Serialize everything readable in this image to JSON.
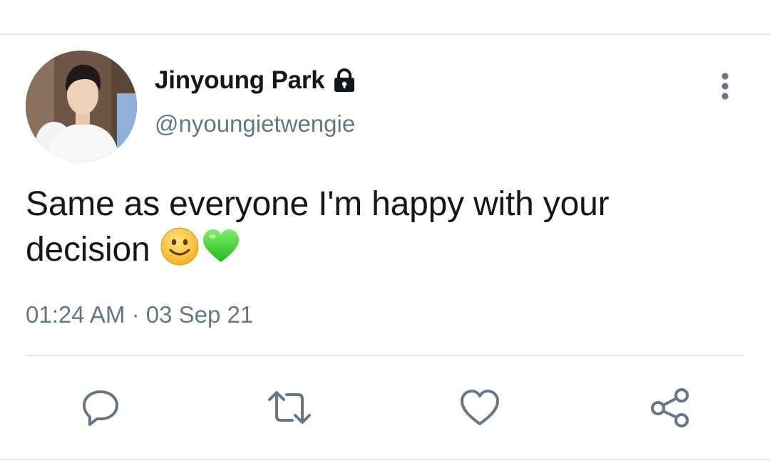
{
  "tweet": {
    "author": {
      "name": "Jinyoung Park",
      "handle": "@nyoungietwengie",
      "protected_icon": "lock-icon",
      "avatar_icon": "profile-photo"
    },
    "text": "Same as everyone I'm happy with your decision",
    "emojis": [
      "slightly-smiling-face-emoji",
      "green-heart-emoji"
    ],
    "timestamp": "01:24 AM · 03 Sep 21",
    "menu_icon": "more-vertical-icon",
    "actions": [
      {
        "name": "reply",
        "icon": "reply-icon"
      },
      {
        "name": "retweet",
        "icon": "retweet-icon"
      },
      {
        "name": "like",
        "icon": "heart-icon"
      },
      {
        "name": "share",
        "icon": "share-icon"
      }
    ]
  },
  "colors": {
    "text_primary": "#14171a",
    "text_secondary": "#657786",
    "divider": "#e6e8ea",
    "icon": "#657786",
    "green_heart": "#3fcf36",
    "emoji_yellow": "#f9c23c"
  }
}
